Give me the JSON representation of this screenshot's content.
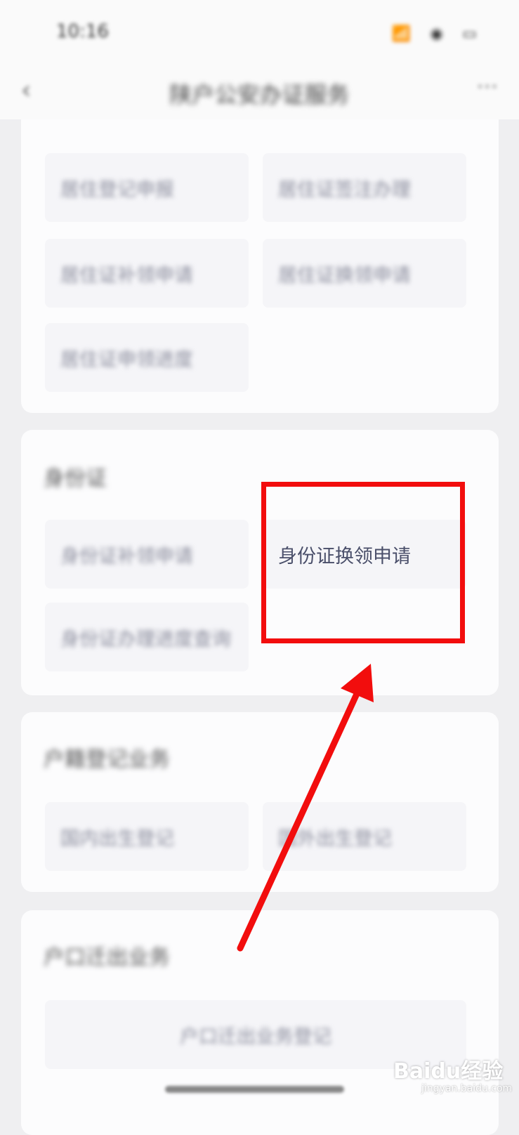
{
  "status_bar": {
    "time": "10:16",
    "icons": "📶 ◉ ▭"
  },
  "header": {
    "back": "‹",
    "title": "陕户公安办证服务",
    "more": "···"
  },
  "card1": {
    "tiles": [
      {
        "label": "居住登记申报"
      },
      {
        "label": "居住证签注办理"
      },
      {
        "label": "居住证补领申请"
      },
      {
        "label": "居住证换领申请"
      },
      {
        "label": "居住证申领进度"
      }
    ]
  },
  "card2": {
    "title": "身份证",
    "tiles": [
      {
        "label": "身份证补领申请"
      },
      {
        "label": "身份证换领申请"
      },
      {
        "label": "身份证办理进度查询"
      }
    ]
  },
  "card3": {
    "title": "户籍登记业务",
    "tiles": [
      {
        "label": "国内出生登记"
      },
      {
        "label": "国外出生登记"
      }
    ]
  },
  "card4": {
    "title": "户口迁出业务",
    "tiles": [
      {
        "label": "户口迁出业务登记"
      }
    ]
  },
  "annotation": {
    "color": "#f20d0d"
  },
  "watermark": {
    "text": "Baidu经验",
    "sub": "jingyan.baidu.com"
  }
}
